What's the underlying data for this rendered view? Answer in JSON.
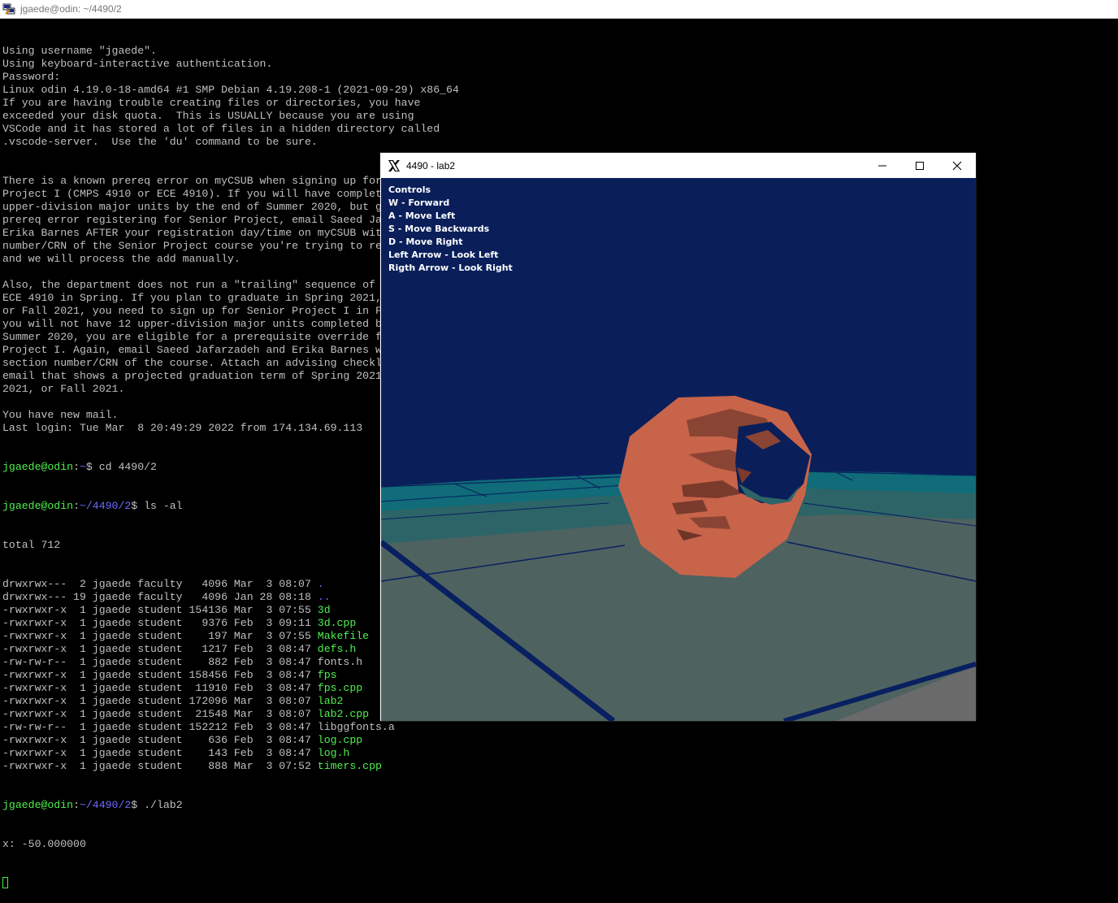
{
  "putty": {
    "title": "jgaede@odin: ~/4490/2",
    "icon": "putty-icon"
  },
  "terminal": {
    "intro": [
      "Using username \"jgaede\".",
      "Using keyboard-interactive authentication.",
      "Password:",
      "Linux odin 4.19.0-18-amd64 #1 SMP Debian 4.19.208-1 (2021-09-29) x86_64",
      "If you are having trouble creating files or directories, you have",
      "exceeded your disk quota.  This is USUALLY because you are using",
      "VSCode and it has stored a lot of files in a hidden directory called",
      ".vscode-server.  Use the 'du' command to be sure.",
      "",
      "",
      "There is a known prereq error on myCSUB when signing up for Senior",
      "Project I (CMPS 4910 or ECE 4910). If you will have completed 12",
      "upper-division major units by the end of Summer 2020, but get a",
      "prereq error registering for Senior Project, email Saeed Jafarzadeh and",
      "Erika Barnes AFTER your registration day/time on myCSUB with the section",
      "number/CRN of the Senior Project course you're trying to register for,",
      "and we will process the add manually.",
      "",
      "Also, the department does not run a \"trailing\" sequence of CMPS and",
      "ECE 4910 in Spring. If you plan to graduate in Spring 2021, Summer 2021,",
      "or Fall 2021, you need to sign up for Senior Project I in Fall 2020. If",
      "you will not have 12 upper-division major units completed by the end of",
      "Summer 2020, you are eligible for a prerequisite override for Senior",
      "Project I. Again, email Saeed Jafarzadeh and Erika Barnes with the",
      "section number/CRN of the course. Attach an advising checklist or an",
      "email that shows a projected graduation term of Spring 2021, Summer",
      "2021, or Fall 2021.",
      "",
      "You have new mail.",
      "Last login: Tue Mar  8 20:49:29 2022 from 174.134.69.113"
    ],
    "prompt_user": "jgaede@odin",
    "prompt_sep": ":",
    "prompt_home": "~",
    "prompt_dir": "~/4490/2",
    "prompt_end": "$ ",
    "cmd1": "cd 4490/2",
    "cmd2": "ls -al",
    "cmd3": "./lab2",
    "total": "total 712",
    "listing": [
      {
        "meta": "drwxrwx---  2 jgaede faculty   4096 Mar  3 08:07 ",
        "name": ".",
        "color": "blue"
      },
      {
        "meta": "drwxrwx--- 19 jgaede faculty   4096 Jan 28 08:18 ",
        "name": "..",
        "color": "blue"
      },
      {
        "meta": "-rwxrwxr-x  1 jgaede student 154136 Mar  3 07:55 ",
        "name": "3d",
        "color": "green"
      },
      {
        "meta": "-rwxrwxr-x  1 jgaede student   9376 Feb  3 09:11 ",
        "name": "3d.cpp",
        "color": "green"
      },
      {
        "meta": "-rwxrwxr-x  1 jgaede student    197 Mar  3 07:55 ",
        "name": "Makefile",
        "color": "green"
      },
      {
        "meta": "-rwxrwxr-x  1 jgaede student   1217 Feb  3 08:47 ",
        "name": "defs.h",
        "color": "green"
      },
      {
        "meta": "-rw-rw-r--  1 jgaede student    882 Feb  3 08:47 ",
        "name": "fonts.h",
        "color": "white"
      },
      {
        "meta": "-rwxrwxr-x  1 jgaede student 158456 Feb  3 08:47 ",
        "name": "fps",
        "color": "green"
      },
      {
        "meta": "-rwxrwxr-x  1 jgaede student  11910 Feb  3 08:47 ",
        "name": "fps.cpp",
        "color": "green"
      },
      {
        "meta": "-rwxrwxr-x  1 jgaede student 172096 Mar  3 08:07 ",
        "name": "lab2",
        "color": "green"
      },
      {
        "meta": "-rwxrwxr-x  1 jgaede student  21548 Mar  3 08:07 ",
        "name": "lab2.cpp",
        "color": "green"
      },
      {
        "meta": "-rw-rw-r--  1 jgaede student 152212 Feb  3 08:47 ",
        "name": "libggfonts.a",
        "color": "white"
      },
      {
        "meta": "-rwxrwxr-x  1 jgaede student    636 Feb  3 08:47 ",
        "name": "log.cpp",
        "color": "green"
      },
      {
        "meta": "-rwxrwxr-x  1 jgaede student    143 Feb  3 08:47 ",
        "name": "log.h",
        "color": "green"
      },
      {
        "meta": "-rwxrwxr-x  1 jgaede student    888 Mar  3 07:52 ",
        "name": "timers.cpp",
        "color": "green"
      }
    ],
    "output": "x: -50.000000"
  },
  "xwindow": {
    "title": "4490 - lab2",
    "icon": "x-icon",
    "buttons": {
      "minimize": "minimize-icon",
      "maximize": "maximize-icon",
      "close": "close-icon"
    }
  },
  "controls": {
    "heading": "Controls",
    "items": [
      "W - Forward",
      "A - Move Left",
      "S - Move Backwards",
      "D - Move Right",
      "Left Arrow - Look Left",
      "Rigth Arrow - Look Right"
    ]
  },
  "colors": {
    "terminal_bg": "#000000",
    "terminal_fg": "#c0c0c0",
    "prompt_green": "#4ef04e",
    "prompt_blue": "#6b6bff",
    "sky": "#0a1f5a",
    "floor": "#4e6260",
    "grid_line": "#082060",
    "torus": "#c8644a"
  }
}
